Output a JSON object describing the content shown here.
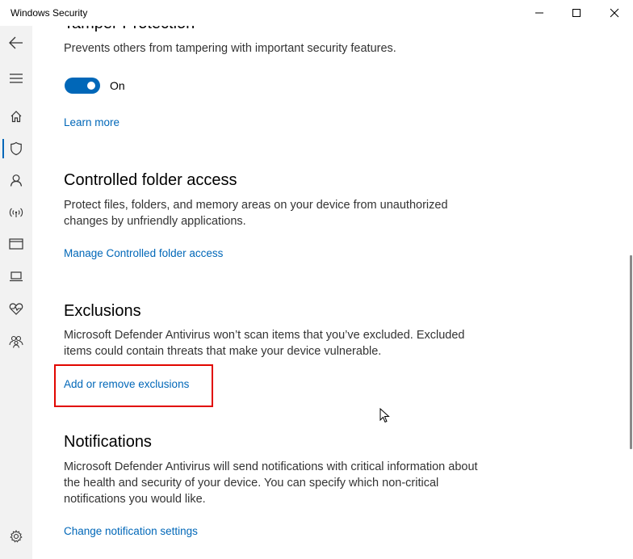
{
  "window": {
    "title": "Windows Security"
  },
  "sidebar": {
    "items": [
      {
        "icon": "back-arrow-icon"
      },
      {
        "icon": "hamburger-menu-icon"
      },
      {
        "icon": "home-icon"
      },
      {
        "icon": "shield-icon",
        "active": true
      },
      {
        "icon": "person-icon"
      },
      {
        "icon": "wifi-icon"
      },
      {
        "icon": "app-browser-icon"
      },
      {
        "icon": "laptop-icon"
      },
      {
        "icon": "heart-pulse-icon"
      },
      {
        "icon": "family-icon"
      },
      {
        "icon": "gear-icon"
      }
    ]
  },
  "tamper": {
    "title": "Tamper Protection",
    "description": "Prevents others from tampering with important security features.",
    "toggle_label": "On",
    "toggle_on": true,
    "link": "Learn more"
  },
  "controlled_folder": {
    "title": "Controlled folder access",
    "description": "Protect files, folders, and memory areas on your device from unauthorized changes by unfriendly applications.",
    "link": "Manage Controlled folder access"
  },
  "exclusions": {
    "title": "Exclusions",
    "description": "Microsoft Defender Antivirus won’t scan items that you’ve excluded. Excluded items could contain threats that make your device vulnerable.",
    "link": "Add or remove exclusions"
  },
  "notifications": {
    "title": "Notifications",
    "description": "Microsoft Defender Antivirus will send notifications with critical information about the health and security of your device. You can specify which non-critical notifications you would like.",
    "link": "Change notification settings"
  },
  "colors": {
    "accent": "#0067b8",
    "highlight": "#e10600",
    "sidebar_bg": "#f2f2f2"
  }
}
